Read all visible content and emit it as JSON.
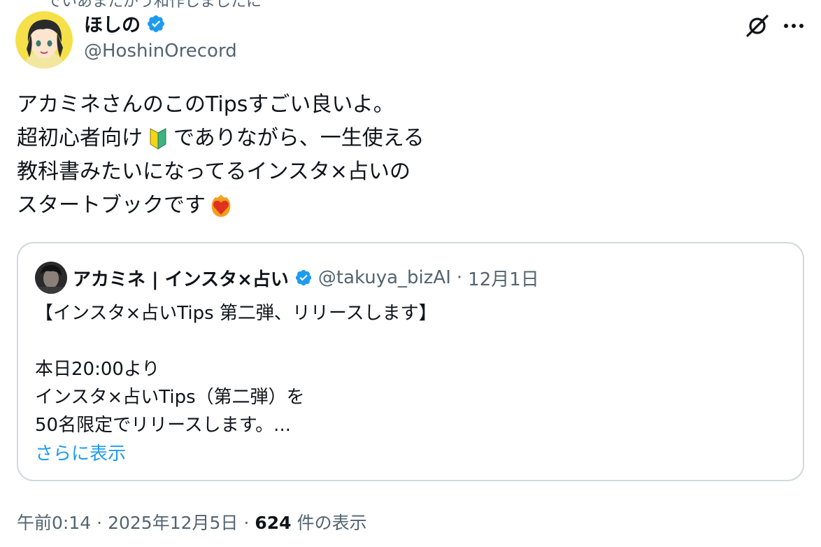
{
  "top_cut_text": "でいあまたがう和作しましたに",
  "author": {
    "display_name": "ほしの",
    "handle": "@HoshinOrecord",
    "verified": true,
    "verified_color": "#1d9bf0"
  },
  "icons": {
    "grok": "grok-icon",
    "more": "more-icon",
    "beginner_emoji": "beginner-mark-icon",
    "fire_heart_emoji": "heart-on-fire-icon"
  },
  "tweet": {
    "lines": [
      "アカミネさんのこのTipsすごい良いよ。",
      "超初心者向け",
      "でありながら、一生使える",
      "教科書みたいになってるインスタ×占いの",
      "スタートブックです"
    ]
  },
  "quote": {
    "display_name": "アカミネ | インスタ×占い",
    "handle": "@takuya_bizAI",
    "separator": "·",
    "date": "12月1日",
    "lines": [
      "【インスタ×占いTips 第二弾、リリースします】",
      "",
      "本日20:00より",
      "インスタ×占いTips（第二弾）を",
      "50名限定でリリースします。..."
    ],
    "show_more": "さらに表示"
  },
  "meta": {
    "time": "午前0:14",
    "separator": "·",
    "date": "2025年12月5日",
    "view_count": "624",
    "view_label": "件の表示"
  },
  "colors": {
    "link": "#1d9bf0",
    "secondary_text": "#536471",
    "border": "#cfd9de"
  }
}
